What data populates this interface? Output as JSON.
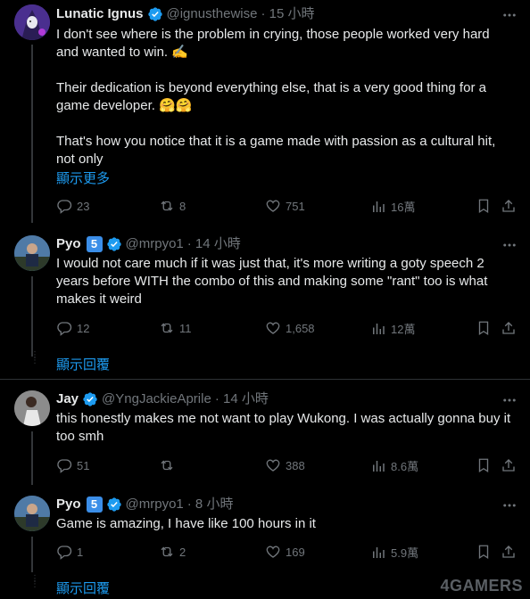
{
  "posts": [
    {
      "name": "Lunatic Ignus",
      "handle": "@ignusthewise",
      "time": "· 15 小時",
      "lines": [
        "I don't see where is the problem in crying, those people worked very hard and wanted to win. ✍️",
        "Their dedication is beyond everything else, that is a very good thing for a game developer. 🤗🤗",
        "That's how you notice that it is a game made with passion as a cultural hit, not only"
      ],
      "show_more": "顯示更多",
      "replies": "23",
      "reposts": "8",
      "likes": "751",
      "views": "16萬"
    },
    {
      "name": "Pyo",
      "badge": "5",
      "handle": "@mrpyo1",
      "time": "· 14 小時",
      "lines": [
        "I would not care much if it was just that, it's more writing a goty speech 2 years before WITH the combo of this and making some \"rant\" too is what makes it weird"
      ],
      "replies": "12",
      "reposts": "11",
      "likes": "1,658",
      "views": "12萬",
      "show_replies": "顯示回覆"
    },
    {
      "name": "Jay",
      "handle": "@YngJackieAprile",
      "time": "· 14 小時",
      "lines": [
        "this honestly makes me not want to play Wukong. I was actually gonna buy it too smh"
      ],
      "replies": "51",
      "reposts": "",
      "likes": "388",
      "views": "8.6萬"
    },
    {
      "name": "Pyo",
      "badge": "5",
      "handle": "@mrpyo1",
      "time": "· 8 小時",
      "lines": [
        "Game is amazing, I have like 100 hours in it"
      ],
      "replies": "1",
      "reposts": "2",
      "likes": "169",
      "views": "5.9萬",
      "show_replies": "顯示回覆"
    }
  ],
  "watermark": "4GAMERS",
  "colors": {
    "background": "#000000",
    "text": "#e7e9ea",
    "muted": "#71767b",
    "link": "#1d9bf0",
    "verified": "#1d9bf0"
  }
}
